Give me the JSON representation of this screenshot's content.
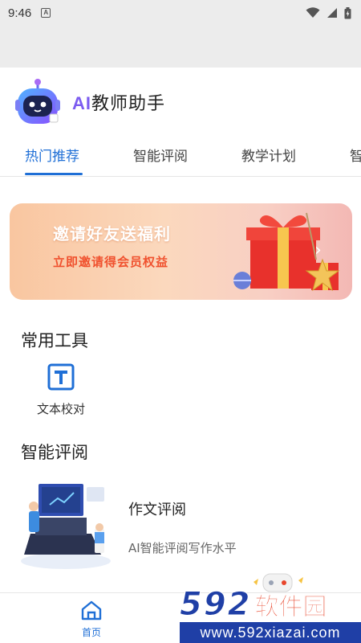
{
  "status_bar": {
    "time": "9:46",
    "notification_glyph": "A"
  },
  "header": {
    "title_prefix": "AI",
    "title_rest": "教师助手",
    "logo": "robot-logo-icon"
  },
  "tabs": [
    {
      "label": "热门推荐",
      "active": true
    },
    {
      "label": "智能评阅",
      "active": false
    },
    {
      "label": "教学计划",
      "active": false
    },
    {
      "label": "智",
      "active": false
    }
  ],
  "banner": {
    "title": "邀请好友送福利",
    "subtitle": "立即邀请得会员权益",
    "arrow": "›"
  },
  "tools_section": {
    "title": "常用工具",
    "items": [
      {
        "label": "文本校对",
        "icon": "text-t-icon"
      }
    ]
  },
  "review_section": {
    "title": "智能评阅",
    "card": {
      "title": "作文评阅",
      "description": "AI智能评阅写作水平"
    }
  },
  "bottom_nav": {
    "items": [
      {
        "label": "首页",
        "icon": "home-icon",
        "active": true
      }
    ]
  },
  "watermark": {
    "number": "592",
    "text": "软件园",
    "url": "www.592xiazai.com"
  },
  "colors": {
    "accent": "#1f6fd6",
    "logo_purple": "#7b5bf0",
    "banner_red": "#f0512e"
  }
}
